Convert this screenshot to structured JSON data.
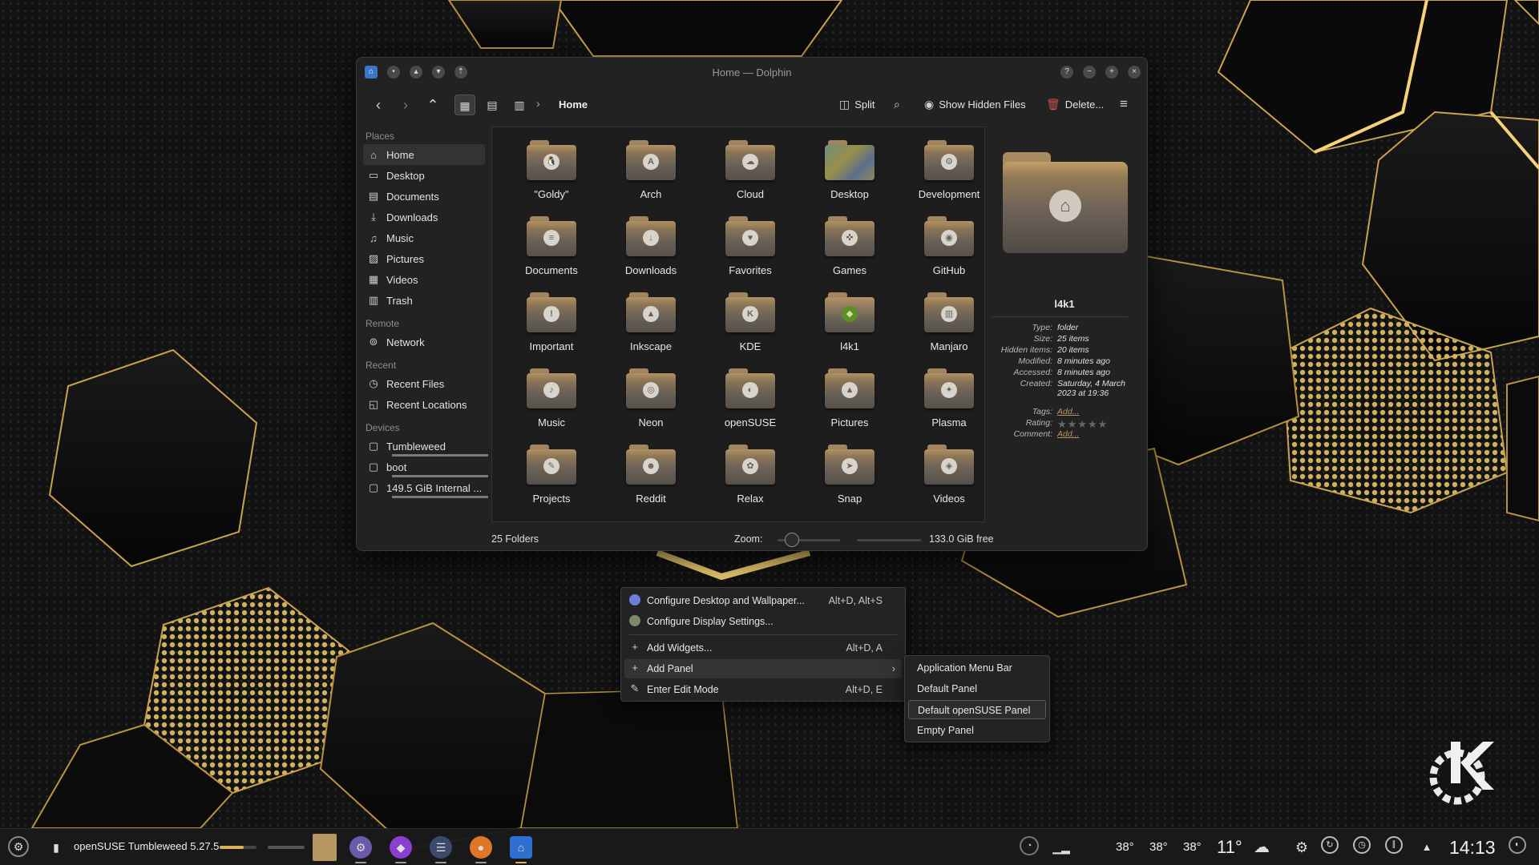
{
  "window": {
    "title": "Home — Dolphin",
    "breadcrumb": "Home",
    "toolbar": {
      "split_label": "Split",
      "hidden_files_label": "Show Hidden Files",
      "delete_label": "Delete..."
    },
    "icons": [
      "back-icon",
      "forward-icon",
      "up-icon",
      "icons-view-icon",
      "compact-view-icon",
      "details-view-icon",
      "search-icon",
      "menu-icon"
    ]
  },
  "sidebar": {
    "places_heading": "Places",
    "places": [
      {
        "label": "Home",
        "icon": "home-icon",
        "glyph": "⌂"
      },
      {
        "label": "Desktop",
        "icon": "desktop-icon",
        "glyph": "▭"
      },
      {
        "label": "Documents",
        "icon": "documents-icon",
        "glyph": "▤"
      },
      {
        "label": "Downloads",
        "icon": "downloads-icon",
        "glyph": "⤓"
      },
      {
        "label": "Music",
        "icon": "music-icon",
        "glyph": "♫"
      },
      {
        "label": "Pictures",
        "icon": "pictures-icon",
        "glyph": "▨"
      },
      {
        "label": "Videos",
        "icon": "videos-icon",
        "glyph": "▦"
      },
      {
        "label": "Trash",
        "icon": "trash-icon",
        "glyph": "▥"
      }
    ],
    "remote_heading": "Remote",
    "remote": [
      {
        "label": "Network",
        "icon": "network-icon",
        "glyph": "⊚"
      }
    ],
    "recent_heading": "Recent",
    "recent": [
      {
        "label": "Recent Files",
        "icon": "recent-files-icon",
        "glyph": "◷"
      },
      {
        "label": "Recent Locations",
        "icon": "recent-locations-icon",
        "glyph": "◱"
      }
    ],
    "devices_heading": "Devices",
    "devices": [
      {
        "label": "Tumbleweed",
        "icon": "drive-icon",
        "glyph": "▢"
      },
      {
        "label": "boot",
        "icon": "drive-icon",
        "glyph": "▢"
      },
      {
        "label": "149.5 GiB Internal ...",
        "icon": "drive-icon",
        "glyph": "▢"
      }
    ]
  },
  "folders": [
    {
      "label": "\"Goldy\"",
      "emblem": "🐧"
    },
    {
      "label": "Arch",
      "emblem": "A"
    },
    {
      "label": "Cloud",
      "emblem": "☁"
    },
    {
      "label": "Desktop",
      "emblem": ""
    },
    {
      "label": "Development",
      "emblem": "⚙"
    },
    {
      "label": "Documents",
      "emblem": "≡"
    },
    {
      "label": "Downloads",
      "emblem": "↓"
    },
    {
      "label": "Favorites",
      "emblem": "♥"
    },
    {
      "label": "Games",
      "emblem": "✜"
    },
    {
      "label": "GitHub",
      "emblem": "◉"
    },
    {
      "label": "Important",
      "emblem": "!"
    },
    {
      "label": "Inkscape",
      "emblem": "▲"
    },
    {
      "label": "KDE",
      "emblem": "K"
    },
    {
      "label": "l4k1",
      "emblem": "◆"
    },
    {
      "label": "Manjaro",
      "emblem": "▥"
    },
    {
      "label": "Music",
      "emblem": "♪"
    },
    {
      "label": "Neon",
      "emblem": "◎"
    },
    {
      "label": "openSUSE",
      "emblem": "◐"
    },
    {
      "label": "Pictures",
      "emblem": "▲"
    },
    {
      "label": "Plasma",
      "emblem": "✦"
    },
    {
      "label": "Projects",
      "emblem": "✎"
    },
    {
      "label": "Reddit",
      "emblem": "☻"
    },
    {
      "label": "Relax",
      "emblem": "✿"
    },
    {
      "label": "Snap",
      "emblem": "➤"
    },
    {
      "label": "Videos",
      "emblem": "◈"
    }
  ],
  "info": {
    "name": "l4k1",
    "props": [
      {
        "key": "Type:",
        "value": "folder"
      },
      {
        "key": "Size:",
        "value": "25 items"
      },
      {
        "key": "Hidden items:",
        "value": "20 items"
      },
      {
        "key": "Modified:",
        "value": "8 minutes ago"
      },
      {
        "key": "Accessed:",
        "value": "8 minutes ago"
      },
      {
        "key": "Created:",
        "value": "Saturday, 4 March 2023 at 19:36"
      },
      {
        "key": "Tags:",
        "value": "Add..."
      },
      {
        "key": "Rating:",
        "value": ""
      },
      {
        "key": "Comment:",
        "value": "Add..."
      }
    ],
    "rating": 0
  },
  "status": {
    "count": "25 Folders",
    "zoom_label": "Zoom:",
    "free": "133.0 GiB free"
  },
  "context_menu": {
    "items": [
      {
        "label": "Configure Desktop and Wallpaper...",
        "shortcut": "Alt+D, Alt+S",
        "icon": "wallpaper-icon"
      },
      {
        "label": "Configure Display Settings...",
        "shortcut": "",
        "icon": "display-icon"
      },
      {
        "label": "Add Widgets...",
        "shortcut": "Alt+D, A",
        "icon": "plus-icon"
      },
      {
        "label": "Add Panel",
        "shortcut": "",
        "icon": "plus-icon"
      },
      {
        "label": "Enter Edit Mode",
        "shortcut": "Alt+D, E",
        "icon": "edit-icon"
      }
    ],
    "submenu": [
      "Application Menu Bar",
      "Default Panel",
      "Default openSUSE Panel",
      "Empty Panel"
    ]
  },
  "panel": {
    "title": "openSUSE Tumbleweed 5.27.5",
    "temps": [
      "38°",
      "38°",
      "38°"
    ],
    "weather": "11°",
    "clock": "14:13"
  },
  "colors": {
    "accent_gold": "#d8b35a",
    "folder_top": "#b39164",
    "folder_bottom": "#55504a",
    "link": "#b8945a"
  }
}
